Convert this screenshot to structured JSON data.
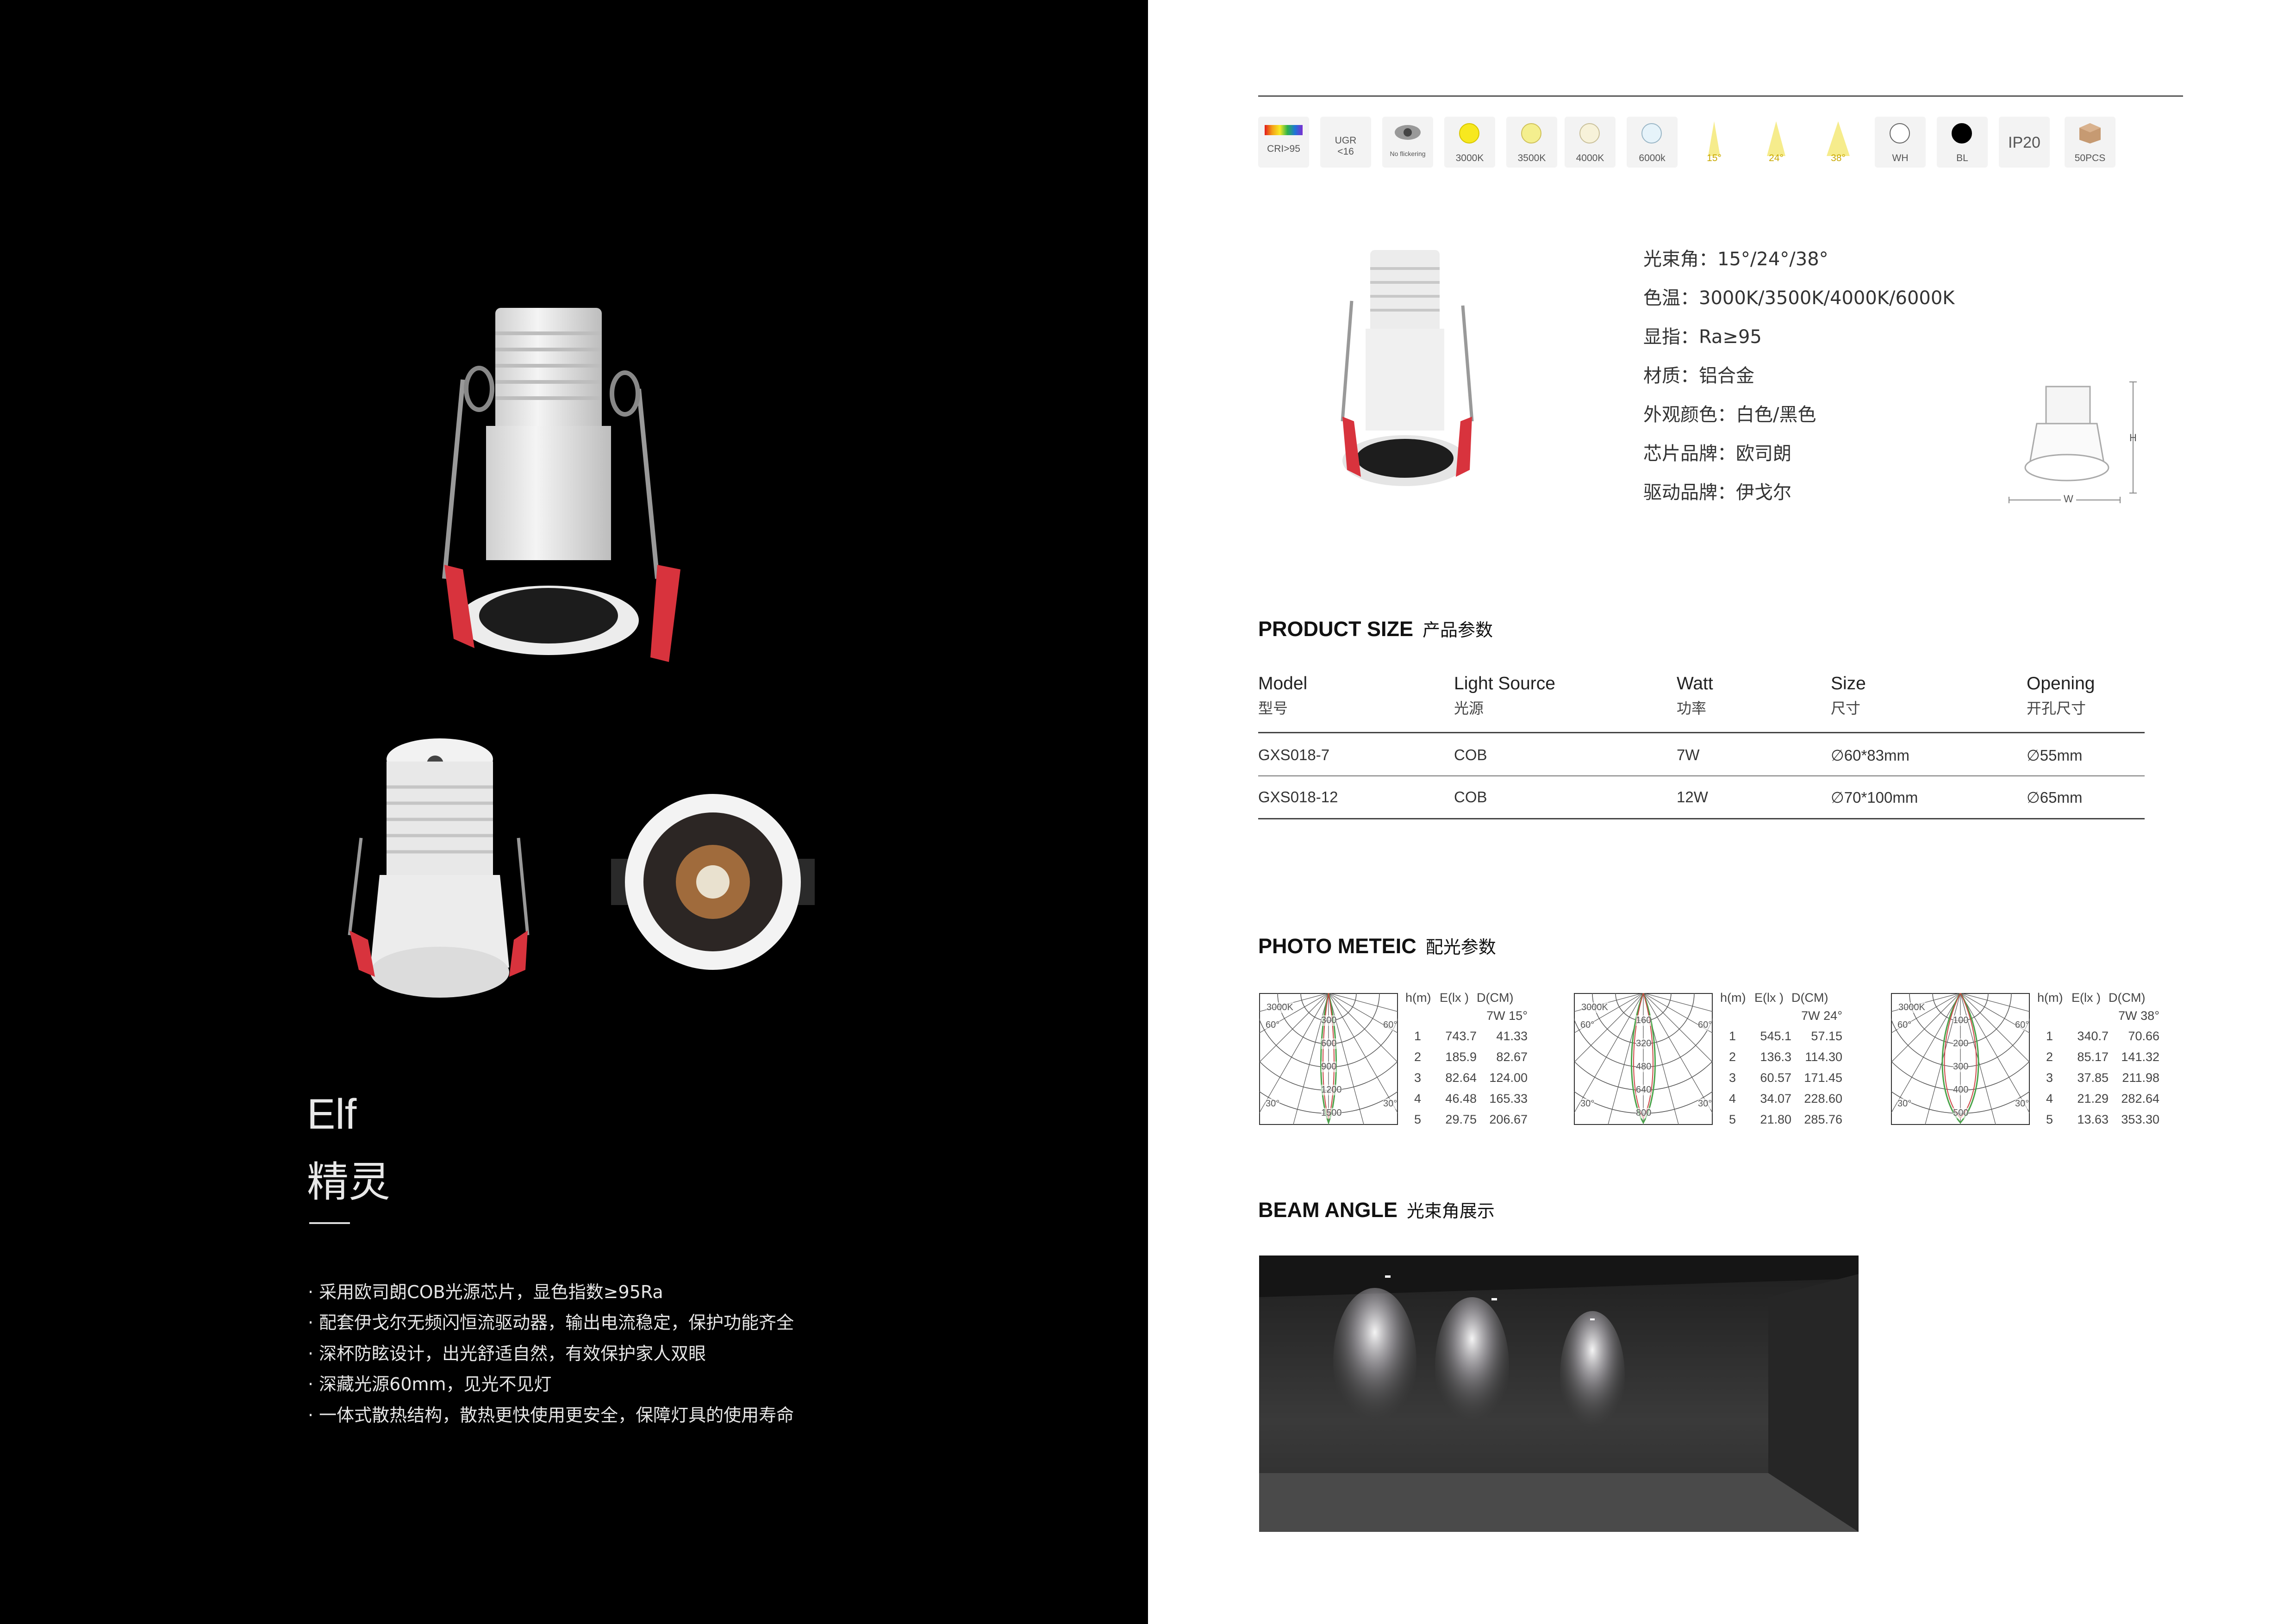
{
  "product": {
    "name_en": "Elf",
    "name_cn": "精灵",
    "features": [
      "· 采用欧司朗COB光源芯片，显色指数≥95Ra",
      "· 配套伊戈尔无频闪恒流驱动器，输出电流稳定，保护功能齐全",
      "· 深杯防眩设计，出光舒适自然，有效保护家人双眼",
      "· 深藏光源60mm，见光不见灯",
      "· 一体式散热结构，散热更快使用更安全，保障灯具的使用寿命"
    ]
  },
  "icons": [
    {
      "name": "cri",
      "label": "CRI>95"
    },
    {
      "name": "ugr",
      "label": "UGR <16"
    },
    {
      "name": "no-flickering",
      "label": "No flickering"
    },
    {
      "name": "cct-3000",
      "label": "3000K",
      "color": "#f7e81f"
    },
    {
      "name": "cct-3500",
      "label": "3500K",
      "color": "#f4ef8e"
    },
    {
      "name": "cct-4000",
      "label": "4000K",
      "color": "#f7f2d9"
    },
    {
      "name": "cct-6000",
      "label": "6000k",
      "color": "#e6f3fa"
    },
    {
      "name": "beam-15",
      "label": "15°"
    },
    {
      "name": "beam-24",
      "label": "24°"
    },
    {
      "name": "beam-38",
      "label": "38°"
    },
    {
      "name": "wh",
      "label": "WH",
      "color": "#ffffff"
    },
    {
      "name": "bl",
      "label": "BL",
      "color": "#000000"
    },
    {
      "name": "ip20",
      "label": "IP20"
    },
    {
      "name": "50pcs",
      "label": "50PCS"
    }
  ],
  "specs": [
    "光束角：15°/24°/38°",
    "色温：3000K/3500K/4000K/6000K",
    "显指：Ra≥95",
    "材质：铝合金",
    "外观颜色：白色/黑色",
    "芯片品牌：欧司朗",
    "驱动品牌：伊戈尔"
  ],
  "dimension_labels": {
    "h": "H",
    "w": "W"
  },
  "product_size": {
    "title": "PRODUCT SIZE",
    "title_cn": "产品参数",
    "columns": [
      {
        "en": "Model",
        "cn": "型号"
      },
      {
        "en": "Light Source",
        "cn": "光源"
      },
      {
        "en": "Watt",
        "cn": "功率"
      },
      {
        "en": "Size",
        "cn": "尺寸"
      },
      {
        "en": "Opening",
        "cn": "开孔尺寸"
      }
    ],
    "rows": [
      [
        "GXS018-7",
        "COB",
        "7W",
        "∅60*83mm",
        "∅55mm"
      ],
      [
        "GXS018-12",
        "COB",
        "12W",
        "∅70*100mm",
        "∅65mm"
      ]
    ]
  },
  "photometric": {
    "title": "PHOTO METEIC",
    "title_cn": "配光参数",
    "headers": [
      "h(m)",
      "E(lx )",
      "D(CM)"
    ],
    "charts": [
      {
        "spec": "7W  15°",
        "polar_labels": [
          "3000K",
          "300",
          "600",
          "900",
          "1200",
          "1500",
          "60°",
          "60°",
          "30°",
          "30°"
        ],
        "rows": [
          [
            "1",
            "743.7",
            "41.33"
          ],
          [
            "2",
            "185.9",
            "82.67"
          ],
          [
            "3",
            "82.64",
            "124.00"
          ],
          [
            "4",
            "46.48",
            "165.33"
          ],
          [
            "5",
            "29.75",
            "206.67"
          ]
        ]
      },
      {
        "spec": "7W  24°",
        "polar_labels": [
          "3000K",
          "160",
          "320",
          "480",
          "640",
          "800",
          "60°",
          "60°",
          "30°",
          "30°"
        ],
        "rows": [
          [
            "1",
            "545.1",
            "57.15"
          ],
          [
            "2",
            "136.3",
            "114.30"
          ],
          [
            "3",
            "60.57",
            "171.45"
          ],
          [
            "4",
            "34.07",
            "228.60"
          ],
          [
            "5",
            "21.80",
            "285.76"
          ]
        ]
      },
      {
        "spec": "7W  38°",
        "polar_labels": [
          "3000K",
          "100",
          "200",
          "300",
          "400",
          "500",
          "60°",
          "60°",
          "30°",
          "30°"
        ],
        "rows": [
          [
            "1",
            "340.7",
            "70.66"
          ],
          [
            "2",
            "85.17",
            "141.32"
          ],
          [
            "3",
            "37.85",
            "211.98"
          ],
          [
            "4",
            "21.29",
            "282.64"
          ],
          [
            "5",
            "13.63",
            "353.30"
          ]
        ]
      }
    ]
  },
  "beam_angle": {
    "title": "BEAM ANGLE",
    "title_cn": "光束角展示"
  }
}
